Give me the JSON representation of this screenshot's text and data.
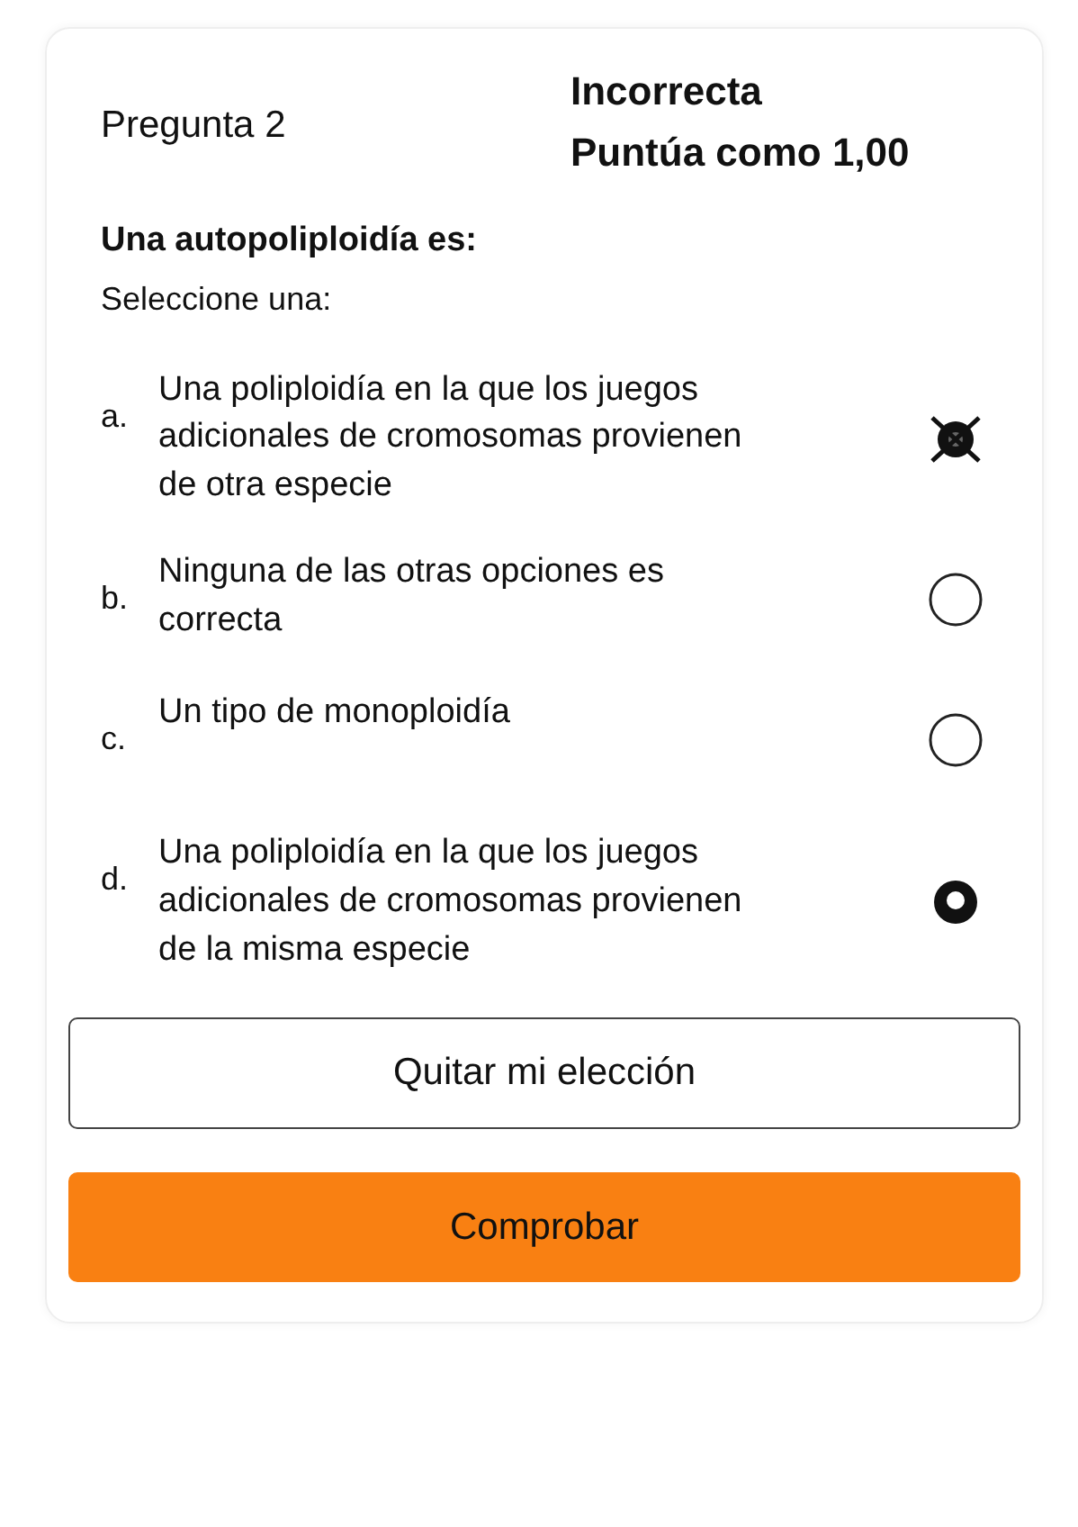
{
  "question": {
    "title": "Pregunta 2",
    "status": "Incorrecta",
    "grade": "Puntúa como 1,00",
    "prompt": "Una autopoliploidía es:",
    "instruction": "Seleccione una:"
  },
  "options": [
    {
      "letter": "a.",
      "text": "Una poliploidía en la que los juegos adicionales de cromosomas provienen de otra especie",
      "filled": true,
      "crossed": true
    },
    {
      "letter": "b.",
      "text": "Ninguna de las otras opciones es correcta",
      "filled": false,
      "crossed": false
    },
    {
      "letter": "c.",
      "text": "Un tipo de monoploidía",
      "filled": false,
      "crossed": false
    },
    {
      "letter": "d.",
      "text": "Una poliploidía en la que los juegos adicionales de cromosomas provienen de la misma especie",
      "filled": true,
      "crossed": false
    }
  ],
  "buttons": [
    {
      "label": "Quitar mi elección",
      "kind": "outline"
    },
    {
      "label": "Comprobar",
      "kind": "primary"
    }
  ]
}
